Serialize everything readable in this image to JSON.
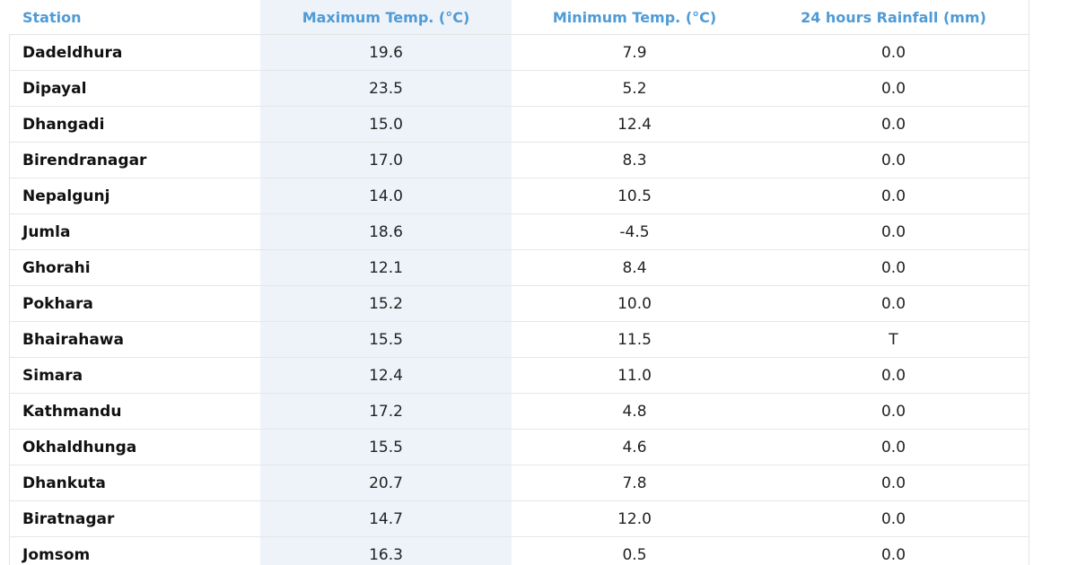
{
  "table": {
    "headers": {
      "station": "Station",
      "max_temp": "Maximum Temp. (°C)",
      "min_temp": "Minimum Temp. (°C)",
      "rainfall": "24 hours Rainfall (mm)"
    },
    "rows": [
      {
        "station": "Dadeldhura",
        "max": "19.6",
        "min": "7.9",
        "rain": "0.0"
      },
      {
        "station": "Dipayal",
        "max": "23.5",
        "min": "5.2",
        "rain": "0.0"
      },
      {
        "station": "Dhangadi",
        "max": "15.0",
        "min": "12.4",
        "rain": "0.0"
      },
      {
        "station": "Birendranagar",
        "max": "17.0",
        "min": "8.3",
        "rain": "0.0"
      },
      {
        "station": "Nepalgunj",
        "max": "14.0",
        "min": "10.5",
        "rain": "0.0"
      },
      {
        "station": "Jumla",
        "max": "18.6",
        "min": "-4.5",
        "rain": "0.0"
      },
      {
        "station": "Ghorahi",
        "max": "12.1",
        "min": "8.4",
        "rain": "0.0"
      },
      {
        "station": "Pokhara",
        "max": "15.2",
        "min": "10.0",
        "rain": "0.0"
      },
      {
        "station": "Bhairahawa",
        "max": "15.5",
        "min": "11.5",
        "rain": "T"
      },
      {
        "station": "Simara",
        "max": "12.4",
        "min": "11.0",
        "rain": "0.0"
      },
      {
        "station": "Kathmandu",
        "max": "17.2",
        "min": "4.8",
        "rain": "0.0"
      },
      {
        "station": "Okhaldhunga",
        "max": "15.5",
        "min": "4.6",
        "rain": "0.0"
      },
      {
        "station": "Dhankuta",
        "max": "20.7",
        "min": "7.8",
        "rain": "0.0"
      },
      {
        "station": "Biratnagar",
        "max": "14.7",
        "min": "12.0",
        "rain": "0.0"
      },
      {
        "station": "Jomsom",
        "max": "16.3",
        "min": "0.5",
        "rain": "0.0"
      }
    ]
  },
  "colors": {
    "header_text": "#4f9bd6",
    "shaded_column": "#eef3f9",
    "row_divider": "#e6e6e6"
  }
}
